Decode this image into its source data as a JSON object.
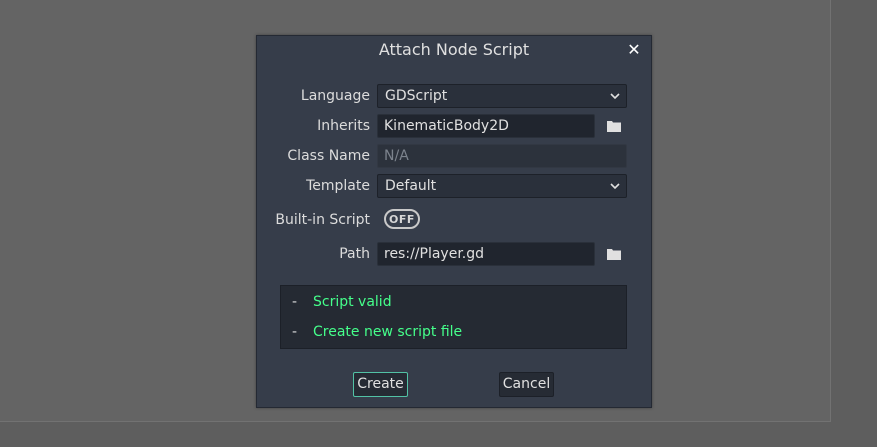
{
  "dialog": {
    "title": "Attach Node Script",
    "close_icon": "close-icon",
    "language": {
      "label": "Language",
      "value": "GDScript"
    },
    "inherits": {
      "label": "Inherits",
      "value": "KinematicBody2D"
    },
    "class_name": {
      "label": "Class Name",
      "placeholder": "N/A"
    },
    "template": {
      "label": "Template",
      "value": "Default"
    },
    "builtin_script": {
      "label": "Built-in Script",
      "toggle_text": "OFF"
    },
    "path": {
      "label": "Path",
      "value": "res://Player.gd"
    },
    "status": [
      {
        "bullet": "-",
        "text": "Script valid"
      },
      {
        "bullet": "-",
        "text": "Create new script file"
      }
    ],
    "buttons": {
      "create": "Create",
      "cancel": "Cancel"
    },
    "colors": {
      "accent": "#52c2a5",
      "status_ok": "#45ff8b",
      "dialog_bg": "#363d4a"
    }
  }
}
